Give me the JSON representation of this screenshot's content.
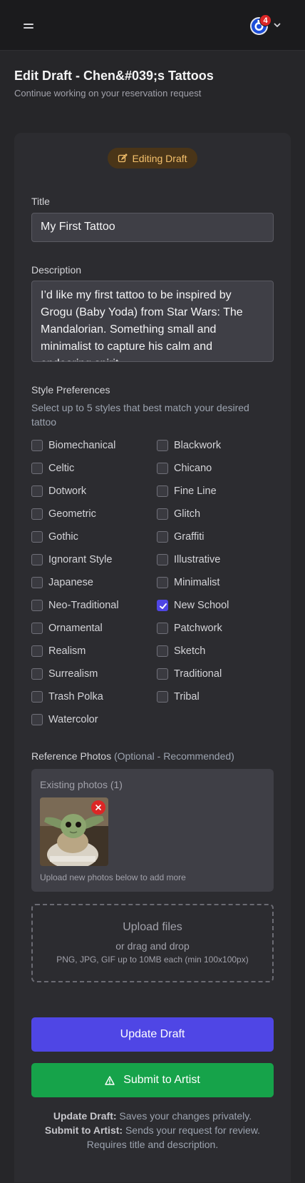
{
  "header": {
    "menu_icon": "hamburger-icon",
    "notification_count": "4",
    "avatar_icon": "user-avatar",
    "caret_icon": "chevron-down-icon"
  },
  "page": {
    "title": "Edit Draft - Chen&#039;s Tattoos",
    "subtitle": "Continue working on your reservation request"
  },
  "status_pill": {
    "label": "Editing Draft",
    "icon": "edit-icon",
    "bg_color": "#4a3518",
    "text_color": "#f5c16c"
  },
  "form": {
    "title_label": "Title",
    "title_value": "My First Tattoo",
    "description_label": "Description",
    "description_value": "I’d like my first tattoo to be inspired by Grogu (Baby Yoda) from Star Wars: The Mandalorian. Something small and minimalist to capture his calm and endearing spirit.",
    "styles_label": "Style Preferences",
    "styles_help": "Select up to 5 styles that best match your desired tattoo",
    "styles": [
      {
        "label": "Biomechanical",
        "checked": false
      },
      {
        "label": "Blackwork",
        "checked": false
      },
      {
        "label": "Celtic",
        "checked": false
      },
      {
        "label": "Chicano",
        "checked": false
      },
      {
        "label": "Dotwork",
        "checked": false
      },
      {
        "label": "Fine Line",
        "checked": false
      },
      {
        "label": "Geometric",
        "checked": false
      },
      {
        "label": "Glitch",
        "checked": false
      },
      {
        "label": "Gothic",
        "checked": false
      },
      {
        "label": "Graffiti",
        "checked": false
      },
      {
        "label": "Ignorant Style",
        "checked": false
      },
      {
        "label": "Illustrative",
        "checked": false
      },
      {
        "label": "Japanese",
        "checked": false
      },
      {
        "label": "Minimalist",
        "checked": false
      },
      {
        "label": "Neo-Traditional",
        "checked": false
      },
      {
        "label": "New School",
        "checked": true
      },
      {
        "label": "Ornamental",
        "checked": false
      },
      {
        "label": "Patchwork",
        "checked": false
      },
      {
        "label": "Realism",
        "checked": false
      },
      {
        "label": "Sketch",
        "checked": false
      },
      {
        "label": "Surrealism",
        "checked": false
      },
      {
        "label": "Traditional",
        "checked": false
      },
      {
        "label": "Trash Polka",
        "checked": false
      },
      {
        "label": "Tribal",
        "checked": false
      },
      {
        "label": "Watercolor",
        "checked": false
      }
    ],
    "photos_label": "Reference Photos",
    "photos_optional": "(Optional - Recommended)",
    "existing_photos_label": "Existing photos (1)",
    "upload_hint": "Upload new photos below to add more",
    "dropzone_title": "Upload files",
    "dropzone_sub": "or drag and drop",
    "dropzone_note": "PNG, JPG, GIF up to 10MB each (min 100x100px)"
  },
  "actions": {
    "update_label": "Update Draft",
    "submit_label": "Submit to Artist",
    "submit_icon": "warning-triangle-icon",
    "update_color": "#4f46e5",
    "submit_color": "#16a34a"
  },
  "footnote": {
    "update_term": "Update Draft:",
    "update_desc": "Saves your changes privately.",
    "submit_term": "Submit to Artist:",
    "submit_desc": "Sends your request for review.",
    "requirement": "Requires title and description."
  }
}
